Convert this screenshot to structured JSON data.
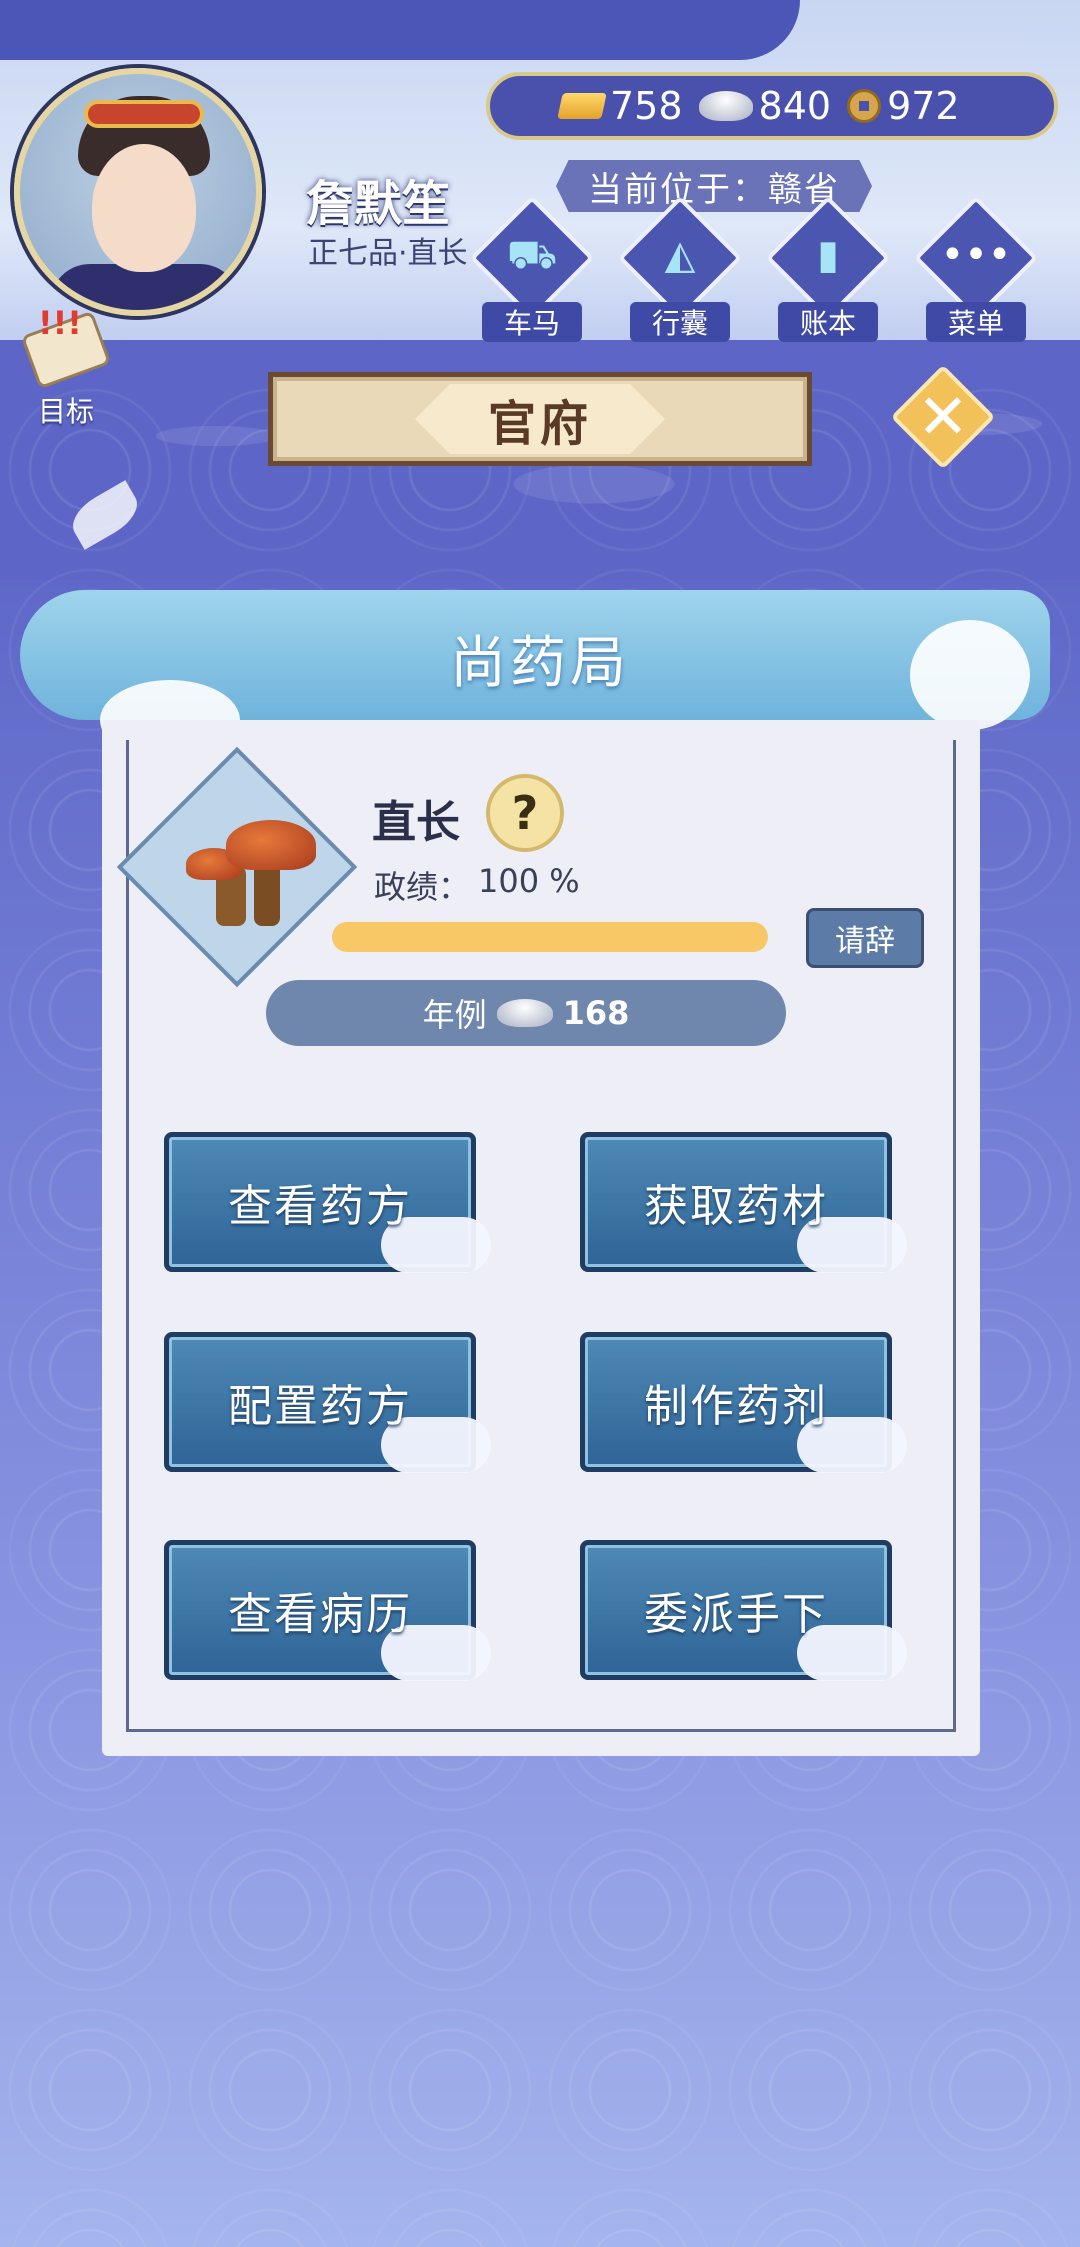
{
  "player": {
    "name": "詹默笙",
    "rank": "正七品·直长"
  },
  "currency": {
    "gold": "758",
    "silver": "840",
    "copper": "972"
  },
  "location": {
    "text": "当前位于：赣省"
  },
  "nav": {
    "carriage": "车马",
    "bag": "行囊",
    "ledger": "账本",
    "menu": "菜单",
    "goal": "目标"
  },
  "office": {
    "title": "官府"
  },
  "department": {
    "title": "尚药局",
    "post": "直长",
    "merit_label": "政绩：",
    "merit_value": "100 %",
    "merit_percent": 100,
    "resign": "请辞",
    "salary_label": "年例",
    "salary_value": "168"
  },
  "actions": [
    "查看药方",
    "获取药材",
    "配置药方",
    "制作药剂",
    "查看病历",
    "委派手下"
  ],
  "colors": {
    "progress": "#f8c867",
    "action_button": "#2e6496",
    "background": "#5a63c4"
  }
}
